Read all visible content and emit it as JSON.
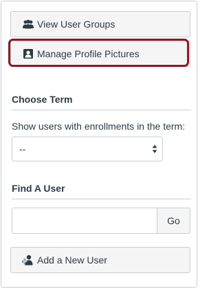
{
  "buttons": {
    "view_user_groups": "View User Groups",
    "manage_profile_pictures": "Manage Profile Pictures",
    "add_new_user": "Add a New User",
    "go": "Go"
  },
  "sections": {
    "choose_term": {
      "title": "Choose Term",
      "label": "Show users with enrollments in the term:",
      "selected": "--"
    },
    "find_user": {
      "title": "Find A User",
      "input_value": "",
      "input_placeholder": ""
    }
  },
  "icons": {
    "view_user_groups": "users-group-icon",
    "manage_profile_pictures": "profile-picture-icon",
    "add_new_user": "add-user-icon",
    "select_arrows": "select-arrows-icon"
  },
  "colors": {
    "highlight": "#8b1a24"
  }
}
